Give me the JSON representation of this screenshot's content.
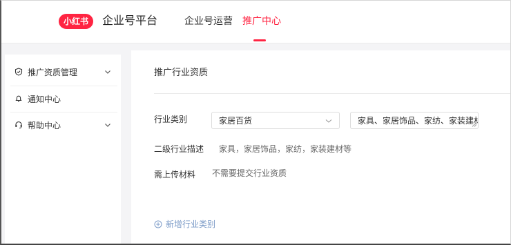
{
  "header": {
    "logo_text": "小红书",
    "brand": "企业号平台",
    "nav": [
      {
        "label": "企业号运营"
      },
      {
        "label": "推广中心",
        "active": true
      }
    ]
  },
  "sidebar": {
    "items": [
      {
        "label": "推广资质管理",
        "icon": "shield-check-icon",
        "expandable": true
      },
      {
        "label": "通知中心",
        "icon": "bell-icon",
        "expandable": false
      },
      {
        "label": "帮助中心",
        "icon": "headset-icon",
        "expandable": true
      }
    ]
  },
  "main": {
    "section_title": "推广行业资质",
    "industry_label": "行业类别",
    "industry_select_value": "家居百货",
    "industry_detail_value": "家具、家居饰品、家纺、家装建材",
    "sub_desc_label": "二级行业描述",
    "sub_desc_value": "家具，家居饰品，家纺，家装建材等",
    "upload_label": "需上传材料",
    "upload_value": "不需要提交行业资质",
    "add_link": "新增行业类别"
  },
  "colors": {
    "brand_red": "#ff2442",
    "link_blue": "#7d9cc8",
    "page_bg": "#f4f4f6"
  }
}
